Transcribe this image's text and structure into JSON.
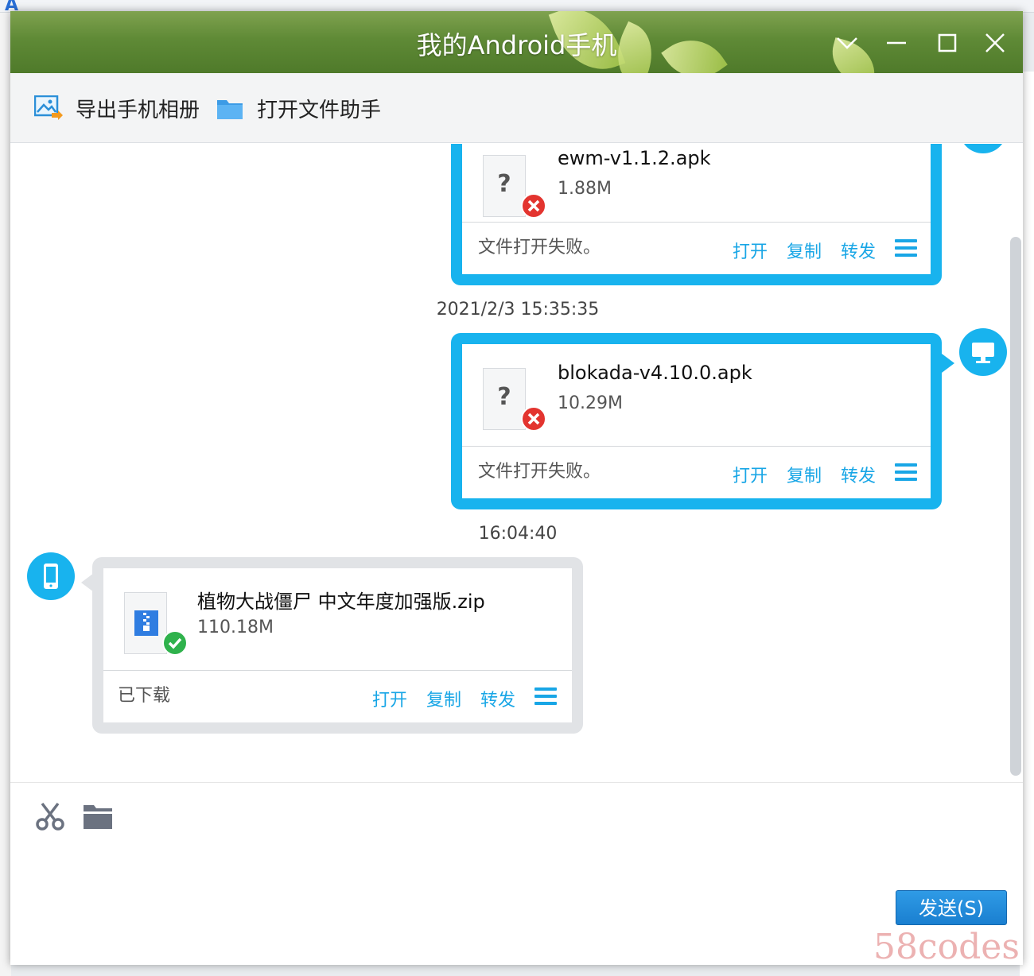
{
  "window": {
    "title": "我的Android手机"
  },
  "toolbar": {
    "export_album": "导出手机相册",
    "open_file_assistant": "打开文件助手"
  },
  "messages": [
    {
      "direction": "out",
      "file_name": "ewm-v1.1.2.apk",
      "size": "1.88M",
      "status": "文件打开失败。",
      "actions": [
        "打开",
        "复制",
        "转发"
      ]
    },
    {
      "direction": "out",
      "time": "2021/2/3 15:35:35",
      "file_name": "blokada-v4.10.0.apk",
      "size": "10.29M",
      "status": "文件打开失败。",
      "actions": [
        "打开",
        "复制",
        "转发"
      ]
    },
    {
      "direction": "in",
      "time": "16:04:40",
      "file_name": "植物大战僵尸 中文年度加强版.zip",
      "size": "110.18M",
      "status": "已下载",
      "actions": [
        "打开",
        "复制",
        "转发"
      ]
    }
  ],
  "input": {
    "send_label": "发送(S)"
  },
  "watermark": "58codes",
  "colors": {
    "accent": "#18b3ee",
    "link": "#18a6e6",
    "error": "#e3342f",
    "success": "#2fb24c"
  },
  "icons": [
    "image-export-icon",
    "folder-icon",
    "minimize-icon",
    "maximize-icon",
    "close-icon",
    "chevron-down-icon",
    "monitor-icon",
    "phone-icon",
    "scissors-icon",
    "folder-icon",
    "error-badge-icon",
    "success-badge-icon",
    "zip-file-icon",
    "menu-icon"
  ]
}
